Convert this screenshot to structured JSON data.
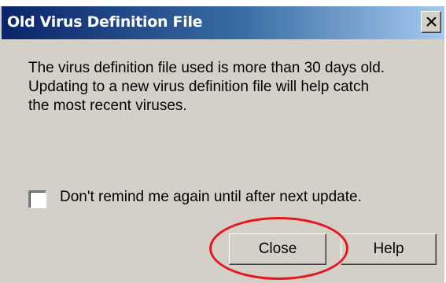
{
  "dialog": {
    "title": "Old Virus Definition File",
    "close_icon": "close-x-icon",
    "message_lines": [
      "The virus definition file used is more than 30 days old.",
      "Updating to a new virus definition file will help catch",
      "the most recent viruses."
    ],
    "checkbox": {
      "label": "Don't remind me again until after next update.",
      "checked": false
    },
    "buttons": {
      "close_label": "Close",
      "help_label": "Help"
    }
  },
  "annotation": {
    "highlight_color": "#e8141e",
    "highlight_target": "close-button"
  },
  "colors": {
    "title_bar_start": "#0a246a",
    "title_bar_end": "#a6caf0",
    "dialog_face": "#d4d0c8"
  }
}
